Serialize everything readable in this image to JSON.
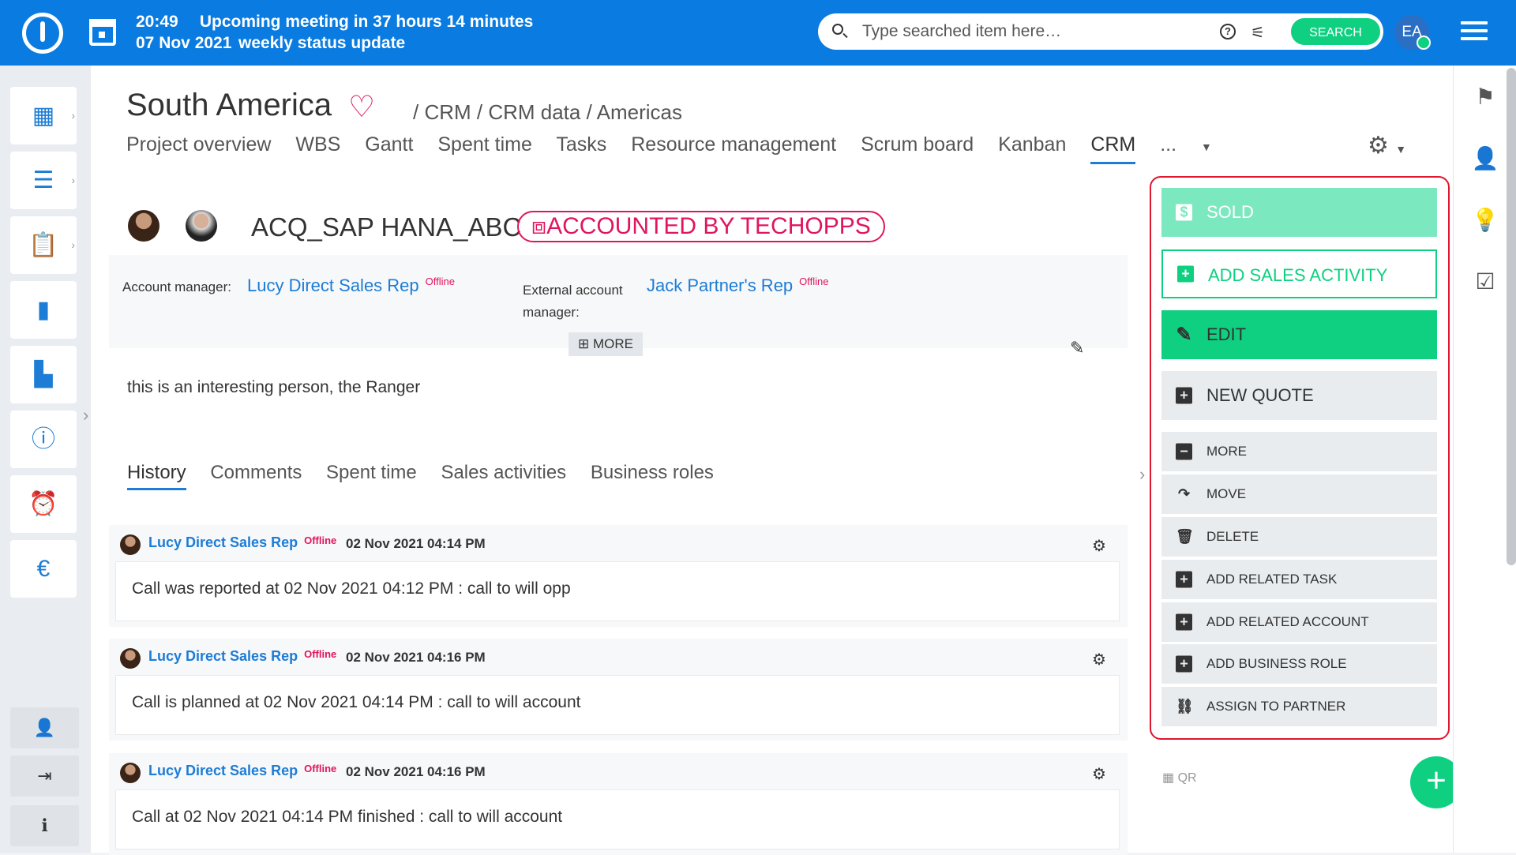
{
  "topbar": {
    "meeting_time": "20:49",
    "meeting_text": "Upcoming meeting in 37 hours 14 minutes",
    "meeting_date": "07 Nov 2021",
    "meeting_title": "weekly status update",
    "search_placeholder": "Type searched item here…",
    "search_button": "SEARCH",
    "user_initials": "EA"
  },
  "project": {
    "title": "South America",
    "breadcrumb": "/ CRM / CRM data / Americas",
    "tabs": [
      "Project overview",
      "WBS",
      "Gantt",
      "Spent time",
      "Tasks",
      "Resource management",
      "Scrum board",
      "Kanban",
      "CRM"
    ],
    "tabs_more": "...",
    "active_tab": "CRM"
  },
  "record": {
    "name": "ACQ_SAP HANA_ABC",
    "badge": "ACCOUNTED BY TECHOPPS",
    "account_manager_label": "Account manager:",
    "account_manager": "Lucy Direct Sales Rep",
    "account_manager_status": "Offline",
    "external_manager_label": "External account manager:",
    "external_manager": "Jack Partner's Rep",
    "external_manager_status": "Offline",
    "more_label": "MORE",
    "description": "this is an interesting person, the Ranger"
  },
  "history_tabs": [
    "History",
    "Comments",
    "Spent time",
    "Sales activities",
    "Business roles"
  ],
  "history": [
    {
      "user": "Lucy Direct Sales Rep",
      "status": "Offline",
      "date": "02 Nov 2021 04:14 PM",
      "text": "Call was reported at 02 Nov 2021 04:12 PM : call to will opp"
    },
    {
      "user": "Lucy Direct Sales Rep",
      "status": "Offline",
      "date": "02 Nov 2021 04:16 PM",
      "text": "Call is planned at 02 Nov 2021 04:14 PM : call to will account"
    },
    {
      "user": "Lucy Direct Sales Rep",
      "status": "Offline",
      "date": "02 Nov 2021 04:16 PM",
      "text": "Call at 02 Nov 2021 04:14 PM finished : call to will account"
    }
  ],
  "sidebar_actions": {
    "sold": "SOLD",
    "add_sales_activity": "ADD SALES ACTIVITY",
    "edit": "EDIT",
    "new_quote": "NEW QUOTE",
    "more": "MORE",
    "move": "MOVE",
    "delete": "DELETE",
    "add_related_task": "ADD RELATED TASK",
    "add_related_account": "ADD RELATED ACCOUNT",
    "add_business_role": "ADD BUSINESS ROLE",
    "assign_to_partner": "ASSIGN TO PARTNER"
  },
  "qr_label": "QR",
  "colors": {
    "brand_blue": "#0a7be0",
    "accent_green": "#0ed080",
    "alert_red": "#e0155e"
  }
}
